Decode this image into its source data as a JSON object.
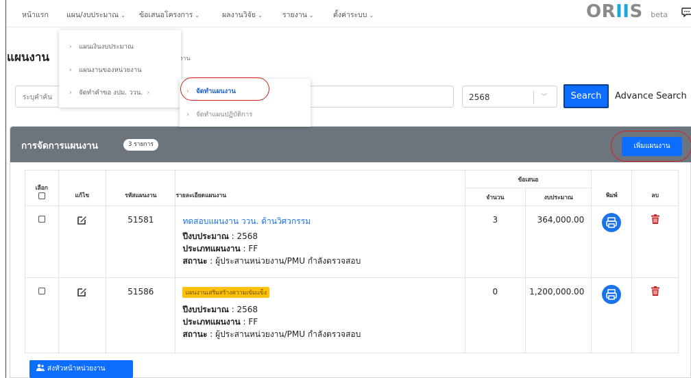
{
  "nav": {
    "items": [
      {
        "label": "หน้าแรก",
        "has_caret": false
      },
      {
        "label": "แผน/งบประมาณ",
        "has_caret": true
      },
      {
        "label": "ข้อเสนอโครงการ",
        "has_caret": true
      },
      {
        "label": "ผลงานวิจัย",
        "has_caret": true
      },
      {
        "label": "รายงาน",
        "has_caret": true
      },
      {
        "label": "ตั้งค่าระบบ",
        "has_caret": true
      }
    ],
    "logo_text": "ORIIS",
    "logo_beta": "beta",
    "chat_icon": "chat-bubble-icon"
  },
  "dropdown": {
    "items": [
      {
        "label": "แผนเงินงบประมาณ"
      },
      {
        "label": "แผนงานของหน่วยงาน"
      },
      {
        "label": "จัดทำคำขอ งปม. ววน.",
        "has_submenu": true
      }
    ],
    "submenu": [
      {
        "label": "จัดทำแผนงาน",
        "active": true
      },
      {
        "label": "จัดทำแผนปฏิบัติการ",
        "active": false
      }
    ]
  },
  "page": {
    "title": "แผนงาน",
    "breadcrumb_tail": "งาน"
  },
  "search": {
    "placeholder": "ระบุคำค้น",
    "year_value": "2568",
    "search_label": "Search",
    "advance_label": "Advance Search"
  },
  "card": {
    "title": "การจัดการแผนงาน",
    "count_badge": "3 รายการ",
    "add_label": "เพิ่มแผนงาน"
  },
  "table": {
    "headers": {
      "select": "เลือก",
      "edit": "แก้ไข",
      "code": "รหัสแผนงาน",
      "detail": "รายละเอียดแผนงาน",
      "proposal_group": "ข้อเสนอ",
      "qty": "จำนวน",
      "budget": "งบประมาณ",
      "print": "พิมพ์",
      "delete": "ลบ"
    },
    "rows": [
      {
        "code": "51581",
        "title_link": "ทดสอบแผนงาน ววน. ด้านวิศวกรรม",
        "tag": "",
        "year_label": "ปีงบประมาณ",
        "year_value": " : 2568",
        "type_label": "ประเภทแผนงาน",
        "type_value": " : FF",
        "status_label": "สถานะ",
        "status_value": " : ผู้ประสานหน่วยงาน/PMU กำลังตรวจสอบ",
        "qty": "3",
        "budget": "364,000.00"
      },
      {
        "code": "51586",
        "title_link": "",
        "tag": "แผนงานเสริมสร้างความเข้มแข็ง",
        "year_label": "ปีงบประมาณ",
        "year_value": " : 2568",
        "type_label": "ประเภทแผนงาน",
        "type_value": " : FF",
        "status_label": "สถานะ",
        "status_value": " : ผู้ประสานหน่วยงาน/PMU กำลังตรวจสอบ",
        "qty": "0",
        "budget": "1,200,000.00"
      }
    ]
  },
  "footer": {
    "send_label": "ส่งหัวหน้าหน่วยงาน"
  },
  "colors": {
    "primary": "#0d6efd",
    "header_gray": "#6c757d",
    "link": "#1a73e8",
    "danger": "#c62828",
    "warning": "#ffc107",
    "highlight_ring": "#d62020"
  }
}
